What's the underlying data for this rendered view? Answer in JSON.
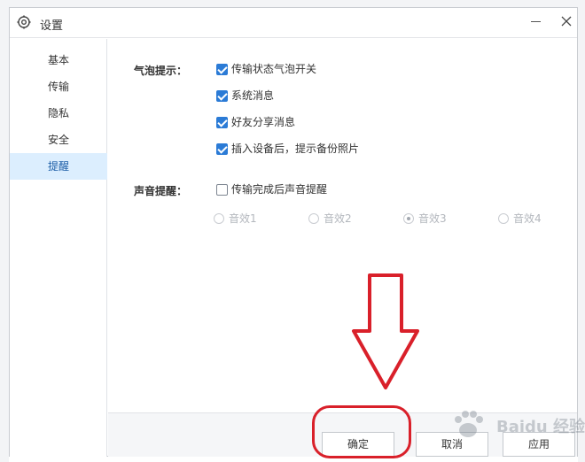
{
  "window": {
    "title": "设置",
    "icon": "gear-icon"
  },
  "sidebar": {
    "items": [
      {
        "label": "基本",
        "active": false
      },
      {
        "label": "传输",
        "active": false
      },
      {
        "label": "隐私",
        "active": false
      },
      {
        "label": "安全",
        "active": false
      },
      {
        "label": "提醒",
        "active": true
      }
    ]
  },
  "bubble": {
    "section_label": "气泡提示：",
    "options": [
      {
        "label": "传输状态气泡开关",
        "checked": true
      },
      {
        "label": "系统消息",
        "checked": true
      },
      {
        "label": "好友分享消息",
        "checked": true
      },
      {
        "label": "插入设备后，提示备份照片",
        "checked": true
      }
    ]
  },
  "sound": {
    "section_label": "声音提醒：",
    "option": {
      "label": "传输完成后声音提醒",
      "checked": false
    },
    "effects": [
      {
        "label": "音效1",
        "selected": false
      },
      {
        "label": "音效2",
        "selected": false
      },
      {
        "label": "音效3",
        "selected": true
      },
      {
        "label": "音效4",
        "selected": false
      }
    ]
  },
  "footer": {
    "ok_label": "确定",
    "cancel_label": "取消",
    "apply_label": "应用"
  },
  "colors": {
    "accent": "#2b7bd6",
    "active_nav_bg": "#dceefe",
    "annotation": "#d9202a"
  },
  "watermark": {
    "text": "Baidu 经验"
  }
}
